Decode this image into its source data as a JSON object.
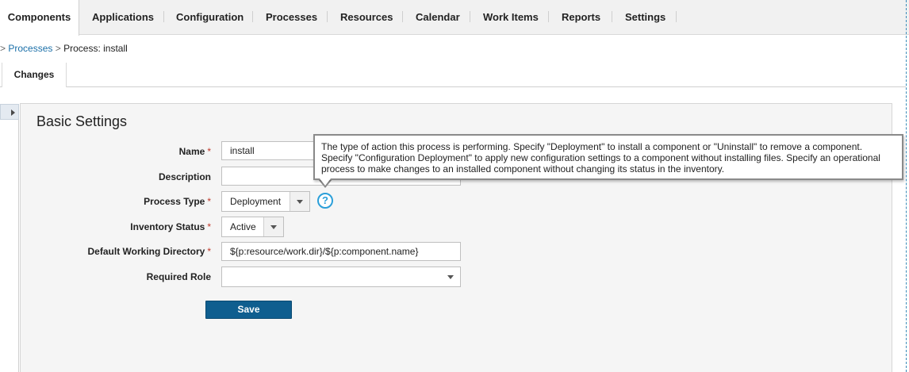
{
  "nav": {
    "tabs": [
      {
        "label": "Components",
        "active": true
      },
      {
        "label": "Applications"
      },
      {
        "label": "Configuration"
      },
      {
        "label": "Processes"
      },
      {
        "label": "Resources"
      },
      {
        "label": "Calendar"
      },
      {
        "label": "Work Items"
      },
      {
        "label": "Reports"
      },
      {
        "label": "Settings"
      }
    ]
  },
  "breadcrumb": {
    "prefix": ">",
    "link": "Processes",
    "separator": ">",
    "current": "Process: install"
  },
  "subtabs": [
    {
      "label": "Changes",
      "active": true
    }
  ],
  "panel": {
    "title": "Basic Settings"
  },
  "form": {
    "name": {
      "label": "Name",
      "value": "install"
    },
    "description": {
      "label": "Description",
      "value": ""
    },
    "process_type": {
      "label": "Process Type",
      "value": "Deployment"
    },
    "inventory_status": {
      "label": "Inventory Status",
      "value": "Active"
    },
    "default_working_directory": {
      "label": "Default Working Directory",
      "value": "${p:resource/work.dir}/${p:component.name}"
    },
    "required_role": {
      "label": "Required Role",
      "value": ""
    },
    "required_marker": "*",
    "help_glyph": "?",
    "save_label": "Save"
  },
  "tooltip": {
    "text": "The type of action this process is performing. Specify \"Deployment\" to install a component or \"Uninstall\" to remove a component. Specify \"Configuration Deployment\" to apply new configuration settings to a component without installing files. Specify an operational process to make changes to an installed component without changing its status in the inventory."
  },
  "colors": {
    "accent": "#0f5e8f",
    "link": "#1a6fa8",
    "required": "#c0392b",
    "help": "#2b9fd9"
  }
}
